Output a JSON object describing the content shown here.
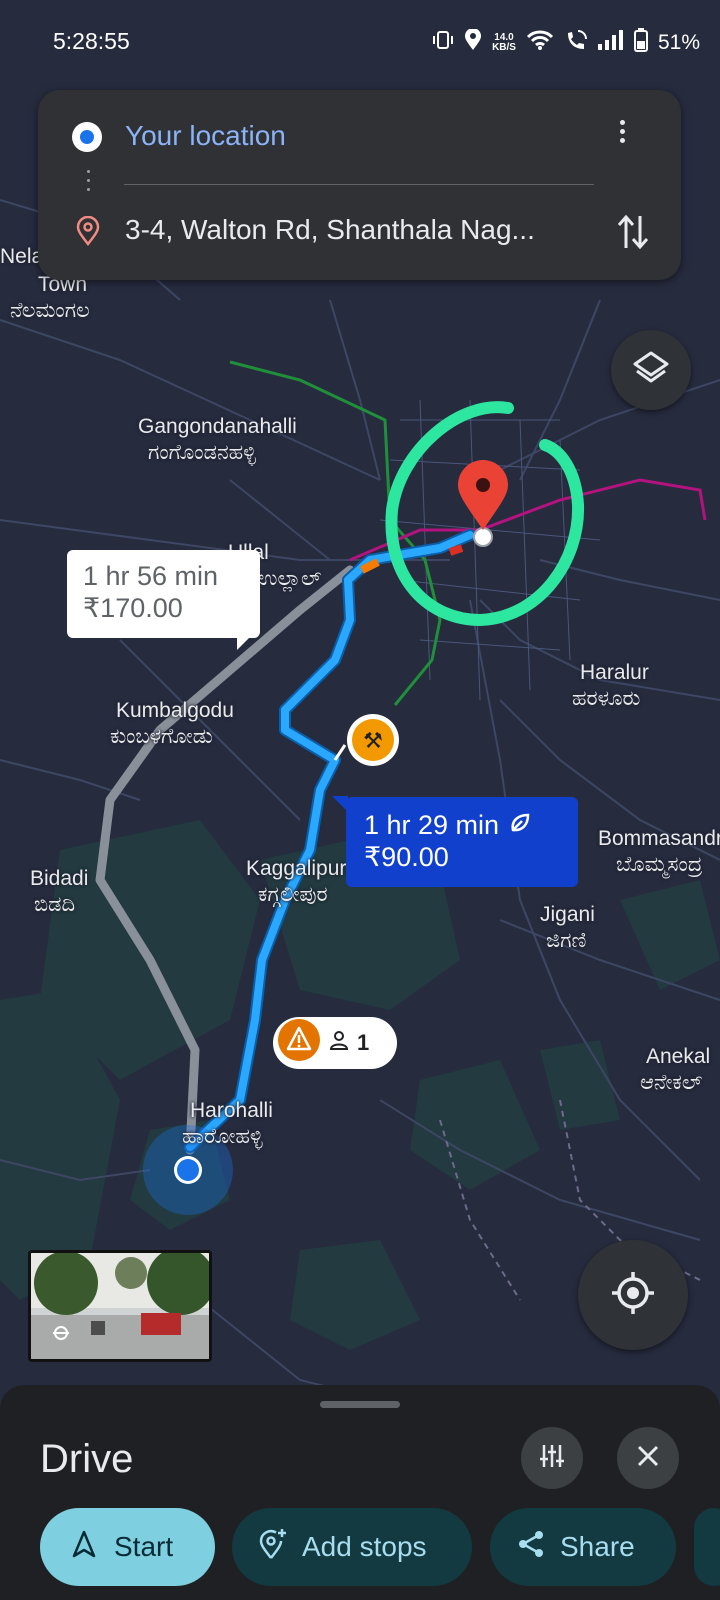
{
  "status_bar": {
    "time": "5:28:55",
    "network_speed_value": "14.0",
    "network_speed_unit": "KB/S",
    "battery": "51%"
  },
  "directions": {
    "origin": "Your location",
    "destination": "3-4, Walton Rd, Shanthala Nag..."
  },
  "map_labels": {
    "nela": "Nela",
    "nela_town": "Town",
    "nela_kn": "ನೆಲಮಂಗಲ",
    "gangondanahalli": "Gangondanahalli",
    "gangondanahalli_kn": "ಗಂಗೊಂಡನಹಳ್ಳಿ",
    "ullal": "Ullal",
    "ullal_kn": "ಉಲ್ಲಾಲ್",
    "kumbalgodu": "Kumbalgodu",
    "kumbalgodu_kn": "ಕುಂಬಳಗೋಡು",
    "bidadi": "Bidadi",
    "bidadi_kn": "ಬಿಡದಿ",
    "kaggalipura": "Kaggalipura",
    "kaggalipura_kn": "ಕಗ್ಗಲೀಪುರ",
    "haralur": "Haralur",
    "haralur_kn": "ಹರಳೂರು",
    "bommasandra": "Bommasandra",
    "bommasandra_kn": "ಬೊಮ್ಮಸಂದ್ರ",
    "jigani": "Jigani",
    "jigani_kn": "ಜಿಗಣಿ",
    "anekal": "Anekal",
    "anekal_kn": "ಆನೇಕಲ್",
    "harohalli": "Harohalli",
    "harohalli_kn": "ಹಾರೋಹಳ್ಳಿ"
  },
  "routes": {
    "alternate": {
      "duration": "1 hr 56 min",
      "toll": "₹170.00"
    },
    "selected": {
      "duration": "1 hr 29 min",
      "toll": "₹90.00"
    },
    "report_count": "1"
  },
  "bottom_sheet": {
    "mode": "Drive",
    "start_label": "Start",
    "add_stops_label": "Add stops",
    "share_label": "Share"
  },
  "colors": {
    "route_selected": "#2aa7ff",
    "route_alternate": "#9aa0a6",
    "highlight_circle": "#2de6a0",
    "destination_pin": "#ea4335"
  }
}
